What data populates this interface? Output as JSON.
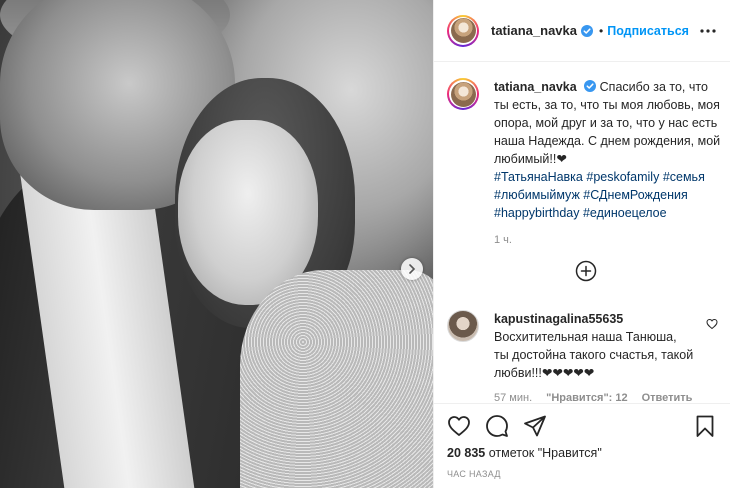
{
  "post": {
    "author": "tatiana_navka",
    "follow_label": "Подписаться",
    "separator": "•",
    "caption": {
      "username": "tatiana_navka",
      "text": "Спасибо за то, что ты есть, за то, что ты моя любовь, моя опора, мой друг и за то, что у нас есть наша Надежда. С днем рождения, мой любимый!!❤",
      "hashtags": [
        "#ТатьянаНавка",
        "#peskofamily",
        "#семья",
        "#любимыймуж",
        "#СДнемРождения",
        "#happybirthday",
        "#единоецелое"
      ],
      "time": "1 ч."
    },
    "comment": {
      "username": "kapustinagalina55635",
      "text": "Восхитительная наша Танюша, ты достойна такого счастья, такой любви!!!❤❤❤❤❤",
      "time": "57 мин.",
      "likes_label": "\"Нравится\": 12",
      "reply_label": "Ответить"
    },
    "likes": {
      "count": "20 835",
      "suffix": " отметок \"Нравится\""
    },
    "timestamp": "ЧАС НАЗАД"
  },
  "icons": {
    "verified": "verified-badge-icon",
    "more": "more-options-icon",
    "heart": "heart-icon",
    "comment": "comment-icon",
    "share": "share-icon",
    "bookmark": "bookmark-icon",
    "load_more": "plus-circle-icon",
    "carousel_next": "chevron-right-icon"
  },
  "colors": {
    "link_blue": "#0095f6",
    "hashtag": "#00376b",
    "verified": "#3897f0",
    "muted": "#8e8e8e"
  }
}
